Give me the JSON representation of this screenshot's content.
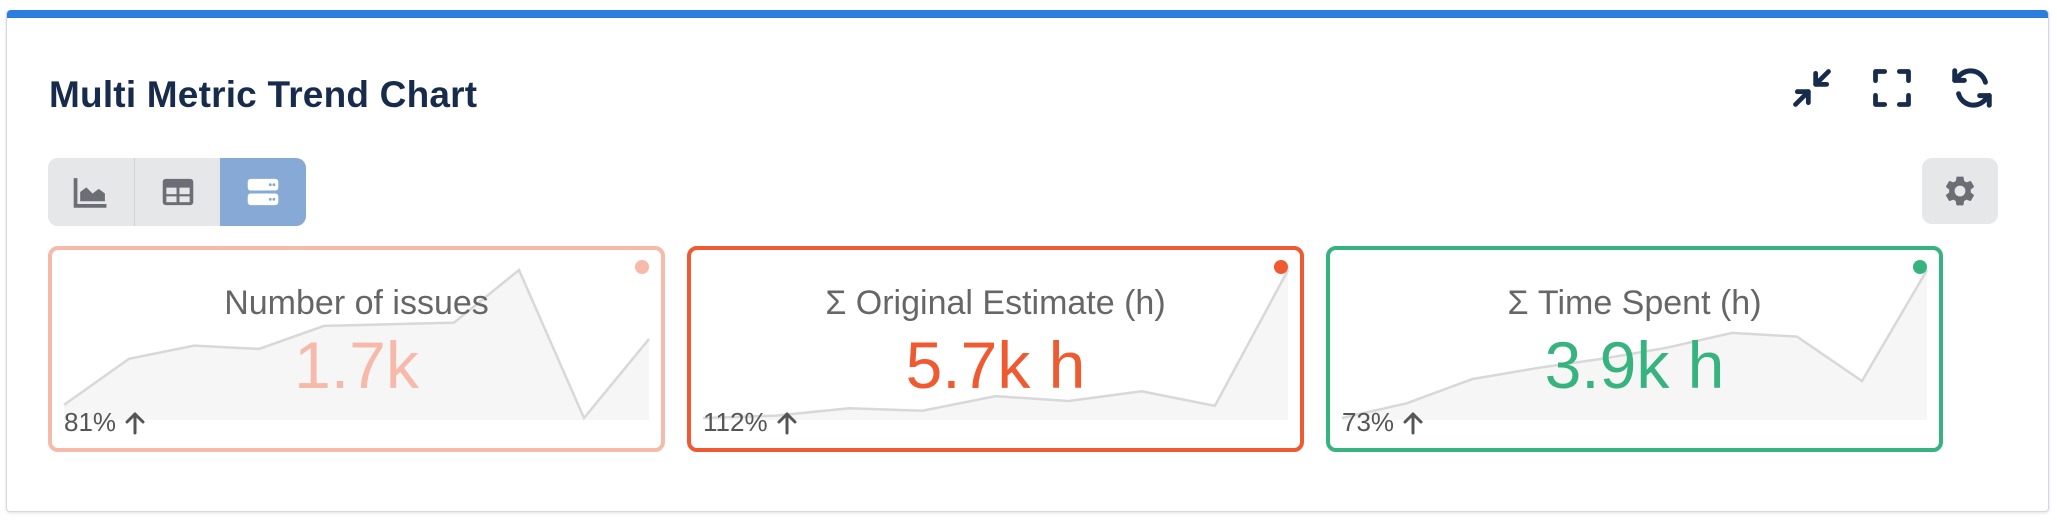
{
  "header": {
    "title": "Multi Metric Trend Chart"
  },
  "header_actions": [
    {
      "name": "collapse-button",
      "icon": "collapse-icon"
    },
    {
      "name": "fullscreen-button",
      "icon": "fullscreen-icon"
    },
    {
      "name": "refresh-button",
      "icon": "refresh-icon"
    }
  ],
  "view_modes": [
    {
      "name": "chart-view",
      "icon": "area-chart-icon",
      "active": false
    },
    {
      "name": "table-view",
      "icon": "table-icon",
      "active": false
    },
    {
      "name": "cards-view",
      "icon": "cards-icon",
      "active": true
    }
  ],
  "settings": {
    "icon": "gear-icon"
  },
  "cards": [
    {
      "title": "Number of issues",
      "value": "1.7k",
      "change": "81%",
      "trend": "up",
      "color": "#f7b9aa",
      "sparkline": [
        8,
        36,
        44,
        42,
        56,
        57,
        58,
        90,
        0,
        48
      ]
    },
    {
      "title": "Σ Original Estimate (h)",
      "value": "5.7k h",
      "change": "112%",
      "trend": "up",
      "color": "#f05a30",
      "sparkline": [
        0,
        1,
        4,
        3,
        9,
        7,
        11,
        5,
        61
      ]
    },
    {
      "title": "Σ Time Spent (h)",
      "value": "3.9k h",
      "change": "73%",
      "trend": "up",
      "color": "#36b37e",
      "sparkline": [
        0,
        8,
        21,
        27,
        32,
        38,
        46,
        44,
        20,
        80
      ]
    }
  ]
}
